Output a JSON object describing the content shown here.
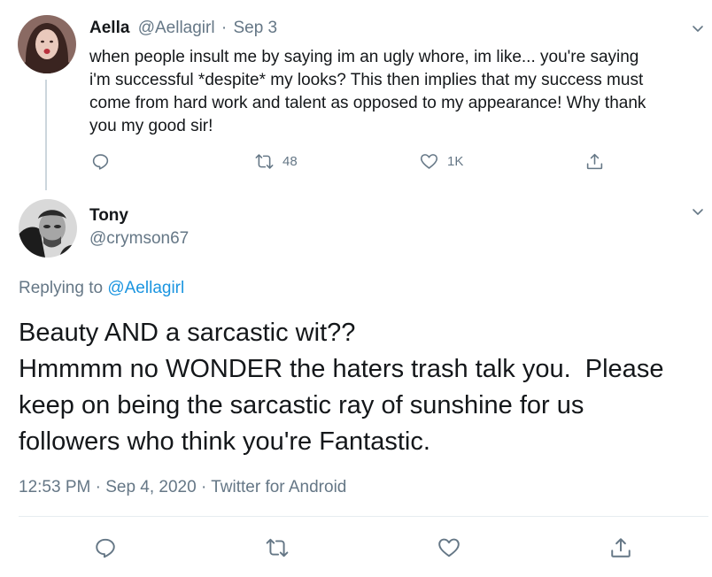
{
  "parent_tweet": {
    "display_name": "Aella",
    "handle": "@Aellagirl",
    "separator": "·",
    "date": "Sep 3",
    "text_lines": [
      "when people insult me by saying im an ugly whore, im like... you're saying",
      "i'm successful *despite* my looks? This then implies that my success must",
      "come from hard work and talent as opposed to my appearance! Why thank",
      "you my good sir!"
    ],
    "actions": {
      "reply_icon": "reply-icon",
      "retweet_icon": "retweet-icon",
      "retweet_count": "48",
      "like_icon": "heart-icon",
      "like_count": "1K",
      "share_icon": "share-icon"
    }
  },
  "main_tweet": {
    "display_name": "Tony",
    "handle": "@crymson67",
    "replying_prefix": "Replying to",
    "replying_to": "@Aellagirl",
    "text_lines": [
      "Beauty AND a sarcastic wit??",
      "Hmmmm no WONDER the haters trash talk you.  Please",
      "keep on being the sarcastic ray of sunshine for us",
      "followers who think you're Fantastic."
    ],
    "meta": "12:53 PM · Sep 4, 2020 · Twitter for Android",
    "actions": {
      "reply_icon": "reply-icon",
      "retweet_icon": "retweet-icon",
      "like_icon": "heart-icon",
      "share_icon": "share-icon"
    }
  },
  "colors": {
    "text": "#14171a",
    "muted": "#657786",
    "link": "#1b95e0",
    "divider": "#e6ecf0",
    "thread_line": "#ccd6dd"
  }
}
